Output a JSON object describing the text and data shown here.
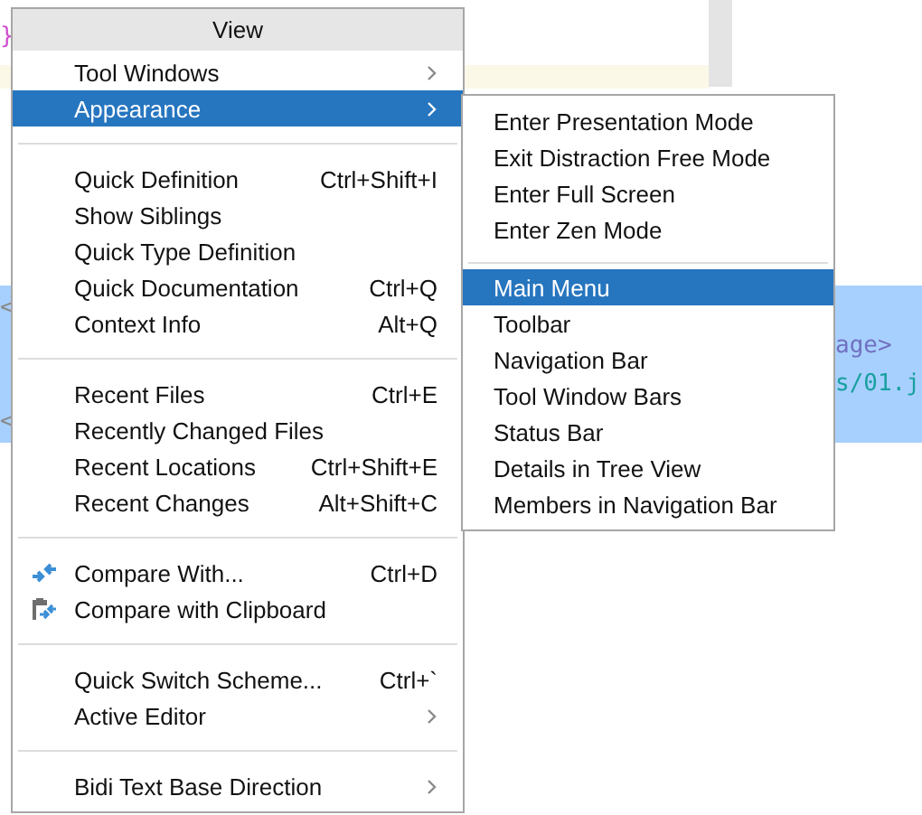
{
  "editor": {
    "lines": [
      {
        "kind": "brace",
        "text": "}",
        "color": "#d050d0"
      }
    ],
    "selection_rows": [
      {
        "left": "<",
        "right": ""
      },
      {
        "left": "",
        "right": "age>"
      },
      {
        "left": "",
        "right": "s/01.j"
      },
      {
        "left": "<",
        "right": ""
      }
    ]
  },
  "menu": {
    "title": "View",
    "items": [
      {
        "kind": "item",
        "label": "Tool Windows",
        "submenu": true,
        "selected": false
      },
      {
        "kind": "item",
        "label": "Appearance",
        "submenu": true,
        "selected": true
      },
      {
        "kind": "separator"
      },
      {
        "kind": "item",
        "label": "Quick Definition",
        "shortcut": "Ctrl+Shift+I",
        "submenu": false,
        "selected": false
      },
      {
        "kind": "item",
        "label": "Show Siblings",
        "submenu": false,
        "selected": false
      },
      {
        "kind": "item",
        "label": "Quick Type Definition",
        "submenu": false,
        "selected": false
      },
      {
        "kind": "item",
        "label": "Quick Documentation",
        "shortcut": "Ctrl+Q",
        "submenu": false,
        "selected": false
      },
      {
        "kind": "item",
        "label": "Context Info",
        "shortcut": "Alt+Q",
        "submenu": false,
        "selected": false
      },
      {
        "kind": "separator"
      },
      {
        "kind": "item",
        "label": "Recent Files",
        "shortcut": "Ctrl+E",
        "submenu": false,
        "selected": false
      },
      {
        "kind": "item",
        "label": "Recently Changed Files",
        "submenu": false,
        "selected": false
      },
      {
        "kind": "item",
        "label": "Recent Locations",
        "shortcut": "Ctrl+Shift+E",
        "submenu": false,
        "selected": false
      },
      {
        "kind": "item",
        "label": "Recent Changes",
        "shortcut": "Alt+Shift+C",
        "submenu": false,
        "selected": false
      },
      {
        "kind": "separator"
      },
      {
        "kind": "icon-item",
        "label": "Compare With...",
        "shortcut": "Ctrl+D",
        "submenu": false,
        "selected": false
      },
      {
        "kind": "icon-item",
        "label": "Compare with Clipboard",
        "submenu": false,
        "selected": false
      },
      {
        "kind": "separator"
      },
      {
        "kind": "item",
        "label": "Quick Switch Scheme...",
        "shortcut": "Ctrl+`",
        "submenu": false,
        "selected": false
      },
      {
        "kind": "item",
        "label": "Active Editor",
        "submenu": true,
        "selected": false
      },
      {
        "kind": "separator"
      },
      {
        "kind": "item",
        "label": "Bidi Text Base Direction",
        "submenu": true,
        "selected": false
      }
    ]
  },
  "submenu": {
    "items": [
      {
        "kind": "item",
        "label": "Enter Presentation Mode",
        "selected": false
      },
      {
        "kind": "item",
        "label": "Exit Distraction Free Mode",
        "selected": false
      },
      {
        "kind": "item",
        "label": "Enter Full Screen",
        "selected": false
      },
      {
        "kind": "item",
        "label": "Enter Zen Mode",
        "selected": false
      },
      {
        "kind": "separator"
      },
      {
        "kind": "item",
        "label": "Main Menu",
        "selected": true
      },
      {
        "kind": "item",
        "label": "Toolbar",
        "selected": false
      },
      {
        "kind": "item",
        "label": "Navigation Bar",
        "selected": false
      },
      {
        "kind": "item",
        "label": "Tool Window Bars",
        "selected": false
      },
      {
        "kind": "item",
        "label": "Status Bar",
        "selected": false
      },
      {
        "kind": "item",
        "label": "Details in Tree View",
        "selected": false
      },
      {
        "kind": "item",
        "label": "Members in Navigation Bar",
        "selected": false
      }
    ]
  }
}
